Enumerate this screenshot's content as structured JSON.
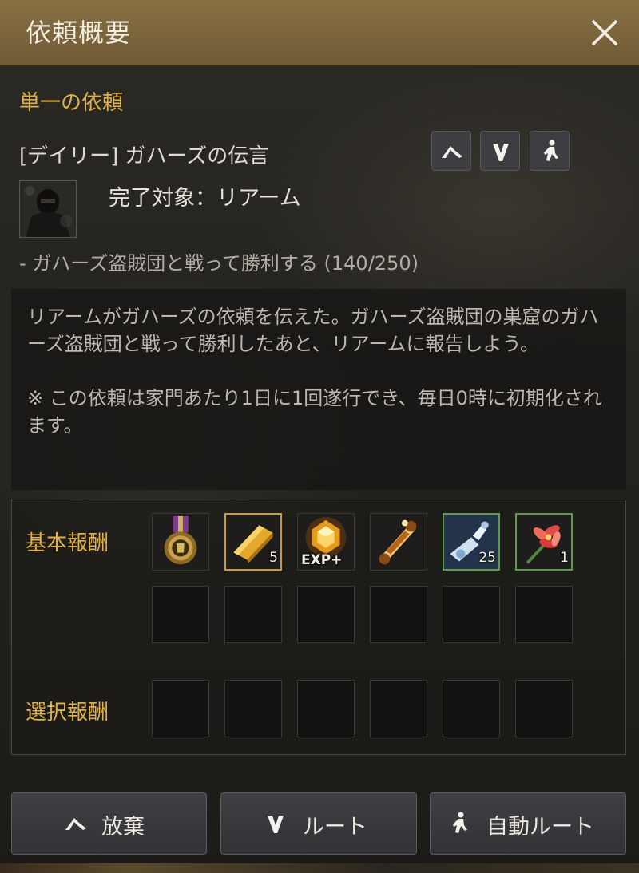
{
  "window": {
    "title": "依頼概要"
  },
  "quest": {
    "section_label": "単一の依頼",
    "name": "[デイリー] ガハーズの伝言",
    "target_label": "完了対象：リアーム",
    "objective": "- ガハーズ盗賊団と戦って勝利する (140/250)",
    "description": "リアームがガハーズの依頼を伝えた。ガハーズ盗賊団の巣窟のガハーズ盗賊団と戦って勝利したあと、リアームに報告しよう。",
    "note": "※ この依頼は家門あたり1日に1回遂行でき、毎日0時に初期化されます。"
  },
  "header_buttons": [
    "abandon-icon",
    "route-icon",
    "auto-route-icon"
  ],
  "rewards": {
    "basic_label": "基本報酬",
    "choice_label": "選択報酬",
    "basic_items": [
      {
        "icon": "medal-icon",
        "qty": ""
      },
      {
        "icon": "gold-bar-icon",
        "qty": "5"
      },
      {
        "icon": "exp-gem-icon",
        "qty": "",
        "caption": "EXP+"
      },
      {
        "icon": "scroll-icon",
        "qty": ""
      },
      {
        "icon": "potion-icon",
        "qty": "25"
      },
      {
        "icon": "flower-icon",
        "qty": "1"
      }
    ]
  },
  "buttons": {
    "abandon": "放棄",
    "route": "ルート",
    "auto_route": "自動ルート"
  },
  "colors": {
    "title_bar": "#7c6540",
    "accent": "#e0b04a",
    "gold_border": "#c99b3c",
    "green_border": "#5d9a4b"
  }
}
